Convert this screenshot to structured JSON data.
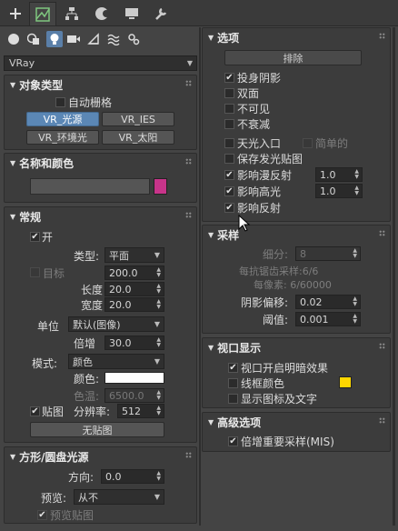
{
  "top_tabs": [
    "create-icon",
    "modify-icon",
    "hierarchy-icon",
    "motion-icon",
    "display-icon",
    "utilities-icon"
  ],
  "sub_tabs": [
    "geometry-icon",
    "shapes-icon",
    "lights-icon",
    "cameras-icon",
    "helpers-icon",
    "spacewarps-icon",
    "systems-icon"
  ],
  "renderer_dropdown": "VRay",
  "object_type": {
    "title": "对象类型",
    "autogrid": "自动栅格",
    "buttons": [
      "VR_光源",
      "VR_IES",
      "VR_环境光",
      "VR_太阳"
    ]
  },
  "name_color": {
    "title": "名称和颜色",
    "name_value": "",
    "color": "#c8348a"
  },
  "general": {
    "title": "常规",
    "on": "开",
    "type_label": "类型:",
    "type_value": "平面",
    "target": "目标",
    "target_value": "200.0",
    "length_label": "长度",
    "length_value": "20.0",
    "width_label": "宽度",
    "width_value": "20.0",
    "unit_label": "单位",
    "unit_value": "默认(图像)",
    "mult_label": "倍增",
    "mult_value": "30.0",
    "mode_label": "模式:",
    "mode_value": "颜色",
    "color_label": "颜色:",
    "color_swatch": "#ffffff",
    "temp_label": "色温:",
    "temp_value": "6500.0",
    "texture": "贴图",
    "res_label": "分辨率:",
    "res_value": "512",
    "no_map": "无贴图"
  },
  "rect_disc": {
    "title": "方形/圆盘光源",
    "dir_label": "方向:",
    "dir_value": "0.0",
    "preview_label": "预览:",
    "preview_value": "从不",
    "preview_map": "预览贴图"
  },
  "options": {
    "title": "选项",
    "exclude": "排除",
    "items": [
      "投身阴影",
      "双面",
      "不可见",
      "不衰减",
      "天光入口",
      "保存发光贴图",
      "影响漫反射",
      "影响高光",
      "影响反射"
    ],
    "simple": "简单的",
    "diffuse_value": "1.0",
    "specular_value": "1.0"
  },
  "sampling": {
    "title": "采样",
    "subdivs_label": "细分:",
    "subdivs_value": "8",
    "aa_text": "每抗锯齿采样:6/6",
    "pixel_text": "每像素: 6/60000",
    "bias_label": "阴影偏移:",
    "bias_value": "0.02",
    "cutoff_label": "阈值:",
    "cutoff_value": "0.001"
  },
  "viewport": {
    "title": "视口显示",
    "items": [
      "视口开启明暗效果",
      "线框颜色",
      "显示图标及文字"
    ],
    "wire_color": "#ffd700"
  },
  "advanced": {
    "title": "高级选项",
    "mis": "倍增重要采样(MIS)"
  }
}
